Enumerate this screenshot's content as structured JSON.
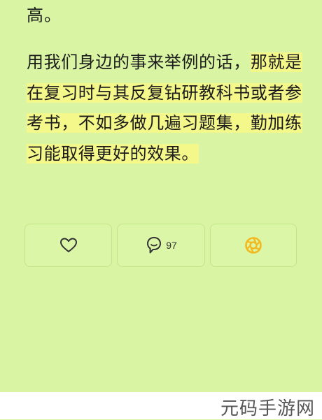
{
  "article": {
    "top_line": "高。",
    "paragraph_plain": "用我们身边的事来举例的话，",
    "paragraph_highlight": "那就是在复习时与其反复钻研教科书或者参考书，不如多做几遍习题集，勤加练习能取得更好的效果。"
  },
  "actions": {
    "like_icon": "heart-icon",
    "comment_icon": "comment-bubble-icon",
    "comment_count": "97",
    "share_icon": "aperture-icon",
    "accent_color": "#f2b81c"
  },
  "watermark": {
    "text": "元码手游网"
  }
}
